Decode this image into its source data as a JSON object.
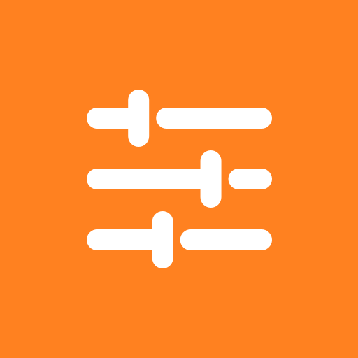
{
  "app_icon": {
    "icon": "sliders-icon",
    "background_color": "#FF8120",
    "foreground_color": "#FFFFFF"
  },
  "sliders": [
    {
      "name": "slider-1",
      "level": 0.28
    },
    {
      "name": "slider-2",
      "level": 0.67
    },
    {
      "name": "slider-3",
      "level": 0.41
    }
  ]
}
